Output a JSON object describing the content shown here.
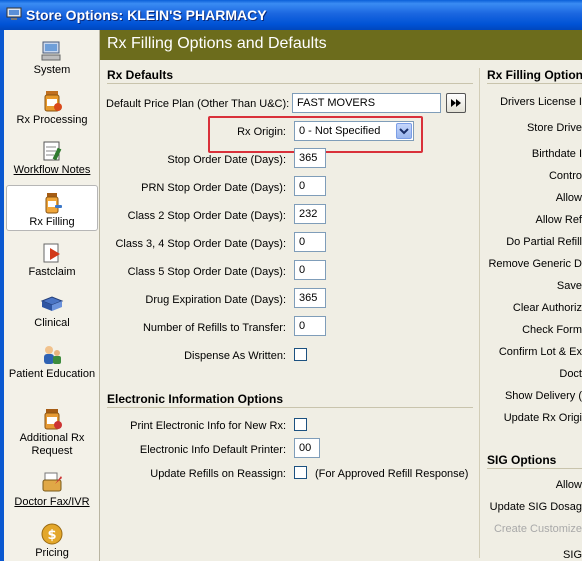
{
  "window": {
    "title": "Store Options: KLEIN'S PHARMACY"
  },
  "sidebar": {
    "items": [
      {
        "label": "System",
        "icon": "computer-icon"
      },
      {
        "label": "Rx Processing",
        "icon": "rx-bottle-icon"
      },
      {
        "label": "Workflow Notes",
        "icon": "notepad-icon"
      },
      {
        "label": "Rx Filling",
        "icon": "pill-bottle-icon",
        "active": true
      },
      {
        "label": "Fastclaim",
        "icon": "claim-icon"
      },
      {
        "label": "Clinical",
        "icon": "book-icon"
      },
      {
        "label": "Patient Education",
        "icon": "people-icon"
      },
      {
        "label": "Additional Rx Request",
        "icon": "prescription-icon"
      },
      {
        "label": "Doctor Fax/IVR",
        "icon": "fax-icon"
      },
      {
        "label": "Pricing",
        "icon": "dollar-icon"
      }
    ]
  },
  "main": {
    "header": "Rx Filling Options and Defaults",
    "rx_defaults": {
      "title": "Rx Defaults",
      "price_plan_label": "Default Price Plan (Other Than U&C):",
      "price_plan_value": "FAST MOVERS",
      "rx_origin_label": "Rx Origin:",
      "rx_origin_value": "0 - Not Specified",
      "stop_order_label": "Stop Order Date (Days):",
      "stop_order_value": "365",
      "prn_stop_label": "PRN Stop Order Date (Days):",
      "prn_stop_value": "0",
      "class2_label": "Class 2 Stop Order Date (Days):",
      "class2_value": "232",
      "class34_label": "Class 3, 4 Stop Order Date (Days):",
      "class34_value": "0",
      "class5_label": "Class 5 Stop Order Date (Days):",
      "class5_value": "0",
      "drug_exp_label": "Drug Expiration Date (Days):",
      "drug_exp_value": "365",
      "refills_label": "Number of Refills to Transfer:",
      "refills_value": "0",
      "daw_label": "Dispense As Written:"
    },
    "electronic": {
      "title": "Electronic Information Options",
      "print_label": "Print Electronic Info for New Rx:",
      "printer_label": "Electronic Info Default Printer:",
      "printer_value": "00",
      "update_label": "Update Refills on Reassign:",
      "update_note": "(For Approved Refill Response)"
    },
    "right": {
      "title": "Rx Filling Options",
      "items": [
        "Drivers License I",
        "Store Drive",
        "Birthdate I",
        "Contro",
        "Allow",
        "Allow Ref",
        "Do Partial Refill",
        "Remove Generic D",
        "Save",
        "Clear Authoriz",
        "Check Form",
        "Confirm Lot & Ex",
        "Doct",
        "Show Delivery (",
        "Update Rx Origi"
      ],
      "sig_title": "SIG Options",
      "sig_items": [
        "Allow",
        "Update SIG Dosag",
        "Create Customize",
        "SIG"
      ]
    }
  }
}
